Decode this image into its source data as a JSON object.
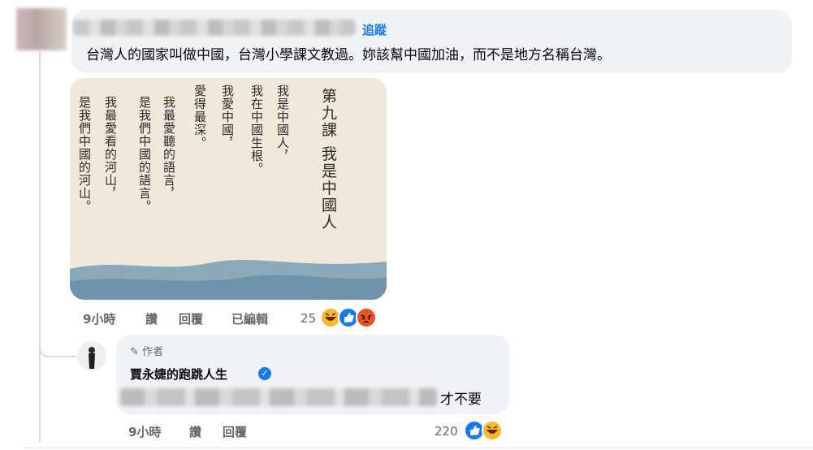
{
  "comment": {
    "follow_label": "追蹤",
    "text": "台灣人的國家叫做中國，台灣小學課文教過。妳該幫中國加油，而不是地方名稱台灣。",
    "time": "9小時",
    "like": "讚",
    "reply": "回覆",
    "edited": "已編輯",
    "reaction_count": "25",
    "reactions": [
      "laugh-react-icon",
      "like-react-icon",
      "angry-react-icon"
    ]
  },
  "textbook": {
    "columns": [
      "第九課  我是中國人",
      "我是中國人，",
      "我在中國生根。",
      "我愛中國，",
      "愛得最深。",
      "我最愛聽的語言，",
      "是我們中國的語言。",
      "我最愛看的河山，",
      "是我們中國的河山。"
    ]
  },
  "reply": {
    "author_tag": "作者",
    "author_name": "賈永婕的跑跳人生",
    "text_suffix": "才不要",
    "time": "9小時",
    "like": "讚",
    "reply": "回覆",
    "reaction_count": "220",
    "reactions": [
      "like-react-icon",
      "laugh-react-icon"
    ]
  },
  "colors": {
    "link": "#1877f2",
    "bubble": "#f0f2f5",
    "meta": "#65676b"
  }
}
